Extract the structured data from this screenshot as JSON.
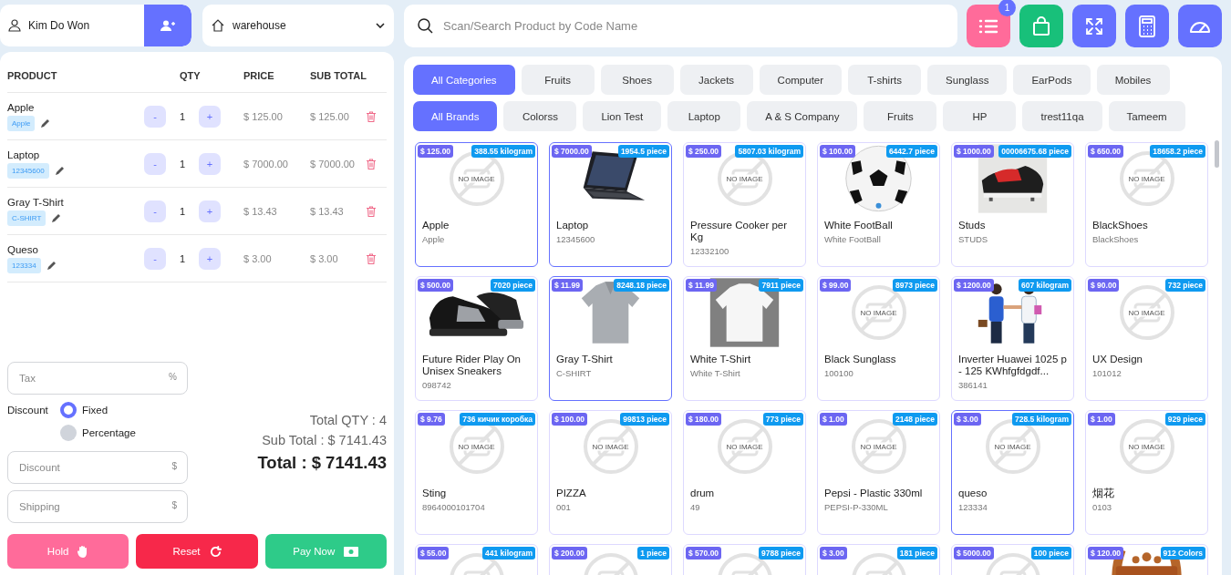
{
  "customer": {
    "name": "Kim Do Won"
  },
  "warehouse": {
    "value": "warehouse"
  },
  "search": {
    "placeholder": "Scan/Search Product by Code Name"
  },
  "toolbar": [
    {
      "kind": "list",
      "badge": "1"
    },
    {
      "kind": "bag"
    },
    {
      "kind": "fullscreen"
    },
    {
      "kind": "calculator"
    },
    {
      "kind": "dashboard"
    }
  ],
  "cart": {
    "columns": [
      "PRODUCT",
      "QTY",
      "PRICE",
      "SUB TOTAL"
    ],
    "rows": [
      {
        "name": "Apple",
        "code": "Apple",
        "minus": "-",
        "qty": "1",
        "plus": "+",
        "price": "$ 125.00",
        "subtotal": "$ 125.00"
      },
      {
        "name": "Laptop",
        "code": "12345600",
        "minus": "-",
        "qty": "1",
        "plus": "+",
        "price": "$ 7000.00",
        "subtotal": "$ 7000.00"
      },
      {
        "name": "Gray T-Shirt",
        "code": "C-SHIRT",
        "minus": "-",
        "qty": "1",
        "plus": "+",
        "price": "$ 13.43",
        "subtotal": "$ 13.43"
      },
      {
        "name": "Queso",
        "code": "123334",
        "minus": "-",
        "qty": "1",
        "plus": "+",
        "price": "$ 3.00",
        "subtotal": "$ 3.00"
      }
    ]
  },
  "tax": {
    "placeholder": "Tax",
    "unit": "%"
  },
  "discount_type": {
    "label": "Discount",
    "options": [
      {
        "label": "Fixed",
        "selected": true
      },
      {
        "label": "Percentage",
        "selected": false
      }
    ]
  },
  "discount": {
    "placeholder": "Discount",
    "unit": "$"
  },
  "shipping": {
    "placeholder": "Shipping",
    "unit": "$"
  },
  "totals": {
    "qty": "Total QTY : 4",
    "subtotal": "Sub Total : $ 7141.43",
    "total": "Total : $ 7141.43"
  },
  "actions": [
    {
      "kind": "hold",
      "label": "Hold"
    },
    {
      "kind": "reset",
      "label": "Reset"
    },
    {
      "kind": "pay",
      "label": "Pay Now"
    }
  ],
  "categories": [
    {
      "label": "All Categories",
      "selected": true
    },
    {
      "label": "Fruits",
      "selected": false
    },
    {
      "label": "Shoes",
      "selected": false
    },
    {
      "label": "Jackets",
      "selected": false
    },
    {
      "label": "Computer",
      "selected": false
    },
    {
      "label": "T-shirts",
      "selected": false
    },
    {
      "label": "Sunglass",
      "selected": false
    },
    {
      "label": "EarPods",
      "selected": false
    },
    {
      "label": "Mobiles",
      "selected": false
    }
  ],
  "brands": [
    {
      "label": "All Brands",
      "selected": true
    },
    {
      "label": "Colorss",
      "selected": false
    },
    {
      "label": "Lion Test",
      "selected": false
    },
    {
      "label": "Laptop",
      "selected": false
    },
    {
      "label": "A & S Company",
      "selected": false
    },
    {
      "label": "Fruits",
      "selected": false
    },
    {
      "label": "HP",
      "selected": false
    },
    {
      "label": "trest11qa",
      "selected": false
    },
    {
      "label": "Tameem",
      "selected": false
    }
  ],
  "products": [
    {
      "price": "$ 125.00",
      "stock": "388.55 kilogram",
      "name": "Apple",
      "code": "Apple",
      "selected": true,
      "image": {
        "kind": "placeholder",
        "label": "NO IMAGE"
      }
    },
    {
      "price": "$ 7000.00",
      "stock": "1954.5 piece",
      "name": "Laptop",
      "code": "12345600",
      "selected": true
    },
    {
      "price": "$ 250.00",
      "stock": "5807.03 kilogram",
      "name": "Pressure Cooker per Kg",
      "code": "12332100",
      "selected": false,
      "image": {
        "kind": "placeholder",
        "label": "NO IMAGE"
      }
    },
    {
      "price": "$ 100.00",
      "stock": "6442.7 piece",
      "name": "White FootBall",
      "code": "White FootBall",
      "selected": false
    },
    {
      "price": "$ 1000.00",
      "stock": "00006675.68 piece",
      "name": "Studs",
      "code": "STUDS",
      "selected": false
    },
    {
      "price": "$ 650.00",
      "stock": "18658.2 piece",
      "name": "BlackShoes",
      "code": "BlackShoes",
      "selected": false,
      "image": {
        "kind": "placeholder",
        "label": "NO IMAGE"
      }
    },
    {
      "price": "$ 500.00",
      "stock": "7020 piece",
      "name": "Future Rider Play On Unisex Sneakers",
      "code": "098742",
      "selected": false
    },
    {
      "price": "$ 11.99",
      "stock": "8248.18 piece",
      "name": "Gray T-Shirt",
      "code": "C-SHIRT",
      "selected": true
    },
    {
      "price": "$ 11.99",
      "stock": "7911 piece",
      "name": "White T-Shirt",
      "code": "White T-Shirt",
      "selected": false
    },
    {
      "price": "$ 99.00",
      "stock": "8973 piece",
      "name": "Black Sunglass",
      "code": "100100",
      "selected": false,
      "image": {
        "kind": "placeholder",
        "label": "NO IMAGE"
      }
    },
    {
      "price": "$ 1200.00",
      "stock": "607 kilogram",
      "name": "Inverter Huawei 1025 p - 125 KWhfgfdgdf...",
      "code": "386141",
      "selected": false
    },
    {
      "price": "$ 90.00",
      "stock": "732 piece",
      "name": "UX Design",
      "code": "101012",
      "selected": false,
      "image": {
        "kind": "placeholder",
        "label": "NO IMAGE"
      }
    },
    {
      "price": "$ 9.76",
      "stock": "736 кичик коробка",
      "name": "Sting",
      "code": "8964000101704",
      "selected": false,
      "image": {
        "kind": "placeholder",
        "label": "NO IMAGE"
      }
    },
    {
      "price": "$ 100.00",
      "stock": "99813 piece",
      "name": "PIZZA",
      "code": "001",
      "selected": false,
      "image": {
        "kind": "placeholder",
        "label": "NO IMAGE"
      }
    },
    {
      "price": "$ 180.00",
      "stock": "773 piece",
      "name": "drum",
      "code": "49",
      "selected": false,
      "image": {
        "kind": "placeholder",
        "label": "NO IMAGE"
      }
    },
    {
      "price": "$ 1.00",
      "stock": "2148 piece",
      "name": "Pepsi - Plastic 330ml",
      "code": "PEPSI-P-330ML",
      "selected": false,
      "image": {
        "kind": "placeholder",
        "label": "NO IMAGE"
      }
    },
    {
      "price": "$ 3.00",
      "stock": "728.5 kilogram",
      "name": "queso",
      "code": "123334",
      "selected": true,
      "image": {
        "kind": "placeholder",
        "label": "NO IMAGE"
      }
    },
    {
      "price": "$ 1.00",
      "stock": "929 piece",
      "name": "烟花",
      "code": "0103",
      "selected": false,
      "image": {
        "kind": "placeholder",
        "label": "NO IMAGE"
      }
    },
    {
      "price": "$ 55.00",
      "stock": "441 kilogram",
      "selected": false,
      "image": {
        "kind": "placeholder"
      }
    },
    {
      "price": "$ 200.00",
      "stock": "1 piece",
      "selected": false,
      "image": {
        "kind": "placeholder"
      }
    },
    {
      "price": "$ 570.00",
      "stock": "9788 piece",
      "selected": false,
      "image": {
        "kind": "placeholder"
      }
    },
    {
      "price": "$ 3.00",
      "stock": "181 piece",
      "selected": false,
      "image": {
        "kind": "placeholder"
      }
    },
    {
      "price": "$ 5000.00",
      "stock": "100 piece",
      "selected": false,
      "image": {
        "kind": "placeholder"
      }
    },
    {
      "price": "$ 120.00",
      "stock": "912 Colors",
      "selected": false
    }
  ]
}
